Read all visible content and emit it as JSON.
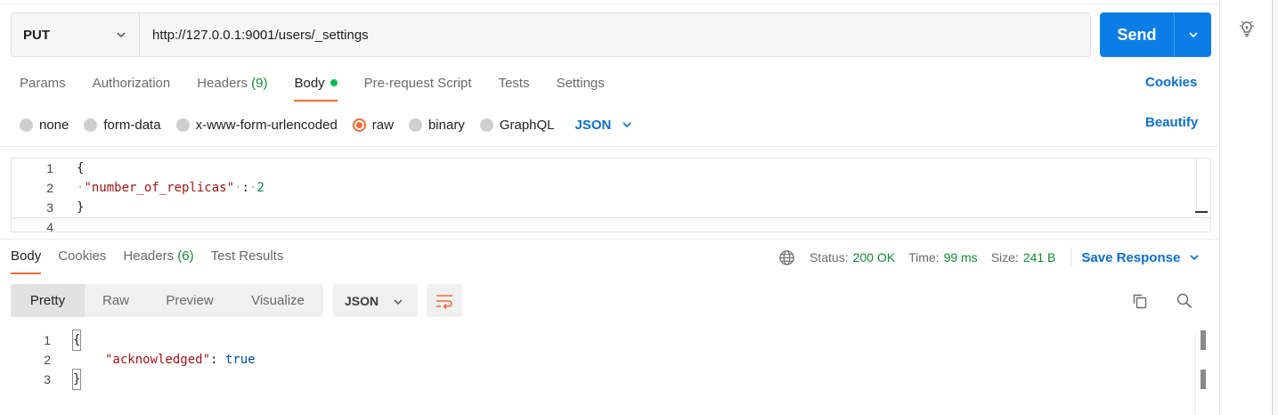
{
  "request": {
    "method": "PUT",
    "url": "http://127.0.0.1:9001/users/_settings",
    "send_label": "Send"
  },
  "request_tabs": {
    "params": "Params",
    "authorization": "Authorization",
    "headers": "Headers",
    "headers_count": "(9)",
    "body": "Body",
    "pre_request": "Pre-request Script",
    "tests": "Tests",
    "settings": "Settings",
    "cookies": "Cookies"
  },
  "body_types": {
    "none": "none",
    "form_data": "form-data",
    "urlencoded": "x-www-form-urlencoded",
    "raw": "raw",
    "binary": "binary",
    "graphql": "GraphQL",
    "language": "JSON",
    "beautify": "Beautify",
    "selected": "raw"
  },
  "request_body": {
    "line_numbers": [
      "1",
      "2",
      "3",
      "4"
    ],
    "open_brace": "{",
    "key": "\"number_of_replicas\"",
    "colon": ":",
    "value": "2",
    "close_brace": "}"
  },
  "response_tabs": {
    "body": "Body",
    "cookies": "Cookies",
    "headers": "Headers",
    "headers_count": "(6)",
    "test_results": "Test Results"
  },
  "response_status": {
    "status_label": "Status:",
    "status_value": "200 OK",
    "time_label": "Time:",
    "time_value": "99 ms",
    "size_label": "Size:",
    "size_value": "241 B",
    "save_response": "Save Response"
  },
  "response_view": {
    "modes": [
      "Pretty",
      "Raw",
      "Preview",
      "Visualize"
    ],
    "active_mode": "Pretty",
    "format": "JSON"
  },
  "response_body": {
    "line_numbers": [
      "1",
      "2",
      "3"
    ],
    "open_brace": "{",
    "key": "\"acknowledged\"",
    "colon": ":",
    "value": "true",
    "close_brace": "}"
  },
  "colors": {
    "accent_orange": "#f26b3a",
    "send_blue": "#0c7de6",
    "link_blue": "#0d6fc9",
    "success_green": "#138a36"
  },
  "icons": [
    "chevron-down-icon",
    "lightbulb-icon",
    "globe-icon",
    "wrap-lines-icon",
    "copy-icon",
    "search-icon"
  ]
}
